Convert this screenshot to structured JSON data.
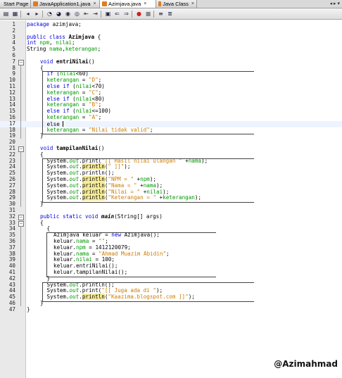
{
  "tabs": [
    {
      "label": "Start Page",
      "icon": "start-page-icon",
      "active": false
    },
    {
      "label": "JavaApplication1.java",
      "icon": "java-file-icon",
      "active": false
    },
    {
      "label": "Azimjava.java",
      "icon": "java-file-icon",
      "active": true
    },
    {
      "label": "Java Class",
      "icon": "java-file-icon",
      "active": false
    }
  ],
  "tab_close": "×",
  "tab_nav": "◂ ▸ ▾",
  "toolbar": {
    "buttons": [
      "source-icon",
      "history-icon",
      "back-icon",
      "forward-icon",
      "find-prev-icon",
      "find-next-icon",
      "find-selection-icon",
      "toggle-highlight-icon",
      "prev-bookmark-icon",
      "next-bookmark-icon",
      "toggle-bookmark-icon",
      "shift-left-icon",
      "shift-right-icon",
      "start-macro-icon",
      "stop-macro-icon",
      "comment-icon",
      "uncomment-icon"
    ]
  },
  "colors": {
    "keyword": "#0000e6",
    "string": "#ce7b00",
    "field": "#009900",
    "highlight": "#f5eb9a"
  },
  "lines": [
    {
      "n": "1",
      "t": "package azimjava;"
    },
    {
      "n": "2",
      "t": ""
    },
    {
      "n": "3",
      "t": "public class Azimjava {"
    },
    {
      "n": "4",
      "t": "int npm, nilai;"
    },
    {
      "n": "5",
      "t": "String nama,keterangan;"
    },
    {
      "n": "6",
      "t": ""
    },
    {
      "n": "7",
      "t": "void entriNilai()"
    },
    {
      "n": "8",
      "t": "{"
    },
    {
      "n": "9",
      "t": "if (nilai<60)"
    },
    {
      "n": "10",
      "t": "keterangan = \"D\";"
    },
    {
      "n": "11",
      "t": "else if (nilai<70)"
    },
    {
      "n": "12",
      "t": "keterangan = \"C\";"
    },
    {
      "n": "13",
      "t": "else if (nilai<80)"
    },
    {
      "n": "14",
      "t": "keterangan = \"B\";"
    },
    {
      "n": "15",
      "t": "else if (nilai<=100)"
    },
    {
      "n": "16",
      "t": "keterangan = \"A\";"
    },
    {
      "n": "17",
      "t": "else"
    },
    {
      "n": "18",
      "t": "keterangan = \"Nilai tidak valid\";"
    },
    {
      "n": "19",
      "t": "}"
    },
    {
      "n": "20",
      "t": ""
    },
    {
      "n": "21",
      "t": "void tampilanNilai()"
    },
    {
      "n": "22",
      "t": "{"
    },
    {
      "n": "23",
      "t": "System.out.print(\"[[ Hasil nilai ulangan \" +nama);"
    },
    {
      "n": "24",
      "t": "System.out.println(\" ]]\");"
    },
    {
      "n": "25",
      "t": "System.out.println();"
    },
    {
      "n": "26",
      "t": "System.out.println(\"NPM = \" +npm);"
    },
    {
      "n": "27",
      "t": "System.out.println(\"Nama = \" +nama);"
    },
    {
      "n": "28",
      "t": "System.out.println(\"Nilai = \" +nilai);"
    },
    {
      "n": "29",
      "t": "System.out.println(\"Keterangan = \" +keterangan);"
    },
    {
      "n": "30",
      "t": "}"
    },
    {
      "n": "31",
      "t": ""
    },
    {
      "n": "32",
      "t": "public static void main(String[] args)"
    },
    {
      "n": "33",
      "t": "{"
    },
    {
      "n": "34",
      "t": "{"
    },
    {
      "n": "35",
      "t": "Azimjava keluar = new Azimjava();"
    },
    {
      "n": "36",
      "t": "keluar.nama = \"\";"
    },
    {
      "n": "37",
      "t": "keluar.npm = 1412120079;"
    },
    {
      "n": "38",
      "t": "keluar.nama = \"Ahmad Muazim Abidin\";"
    },
    {
      "n": "39",
      "t": "keluar.nilai = 100;"
    },
    {
      "n": "40",
      "t": "keluar.entriNilai();"
    },
    {
      "n": "41",
      "t": "keluar.tampilanNilai();"
    },
    {
      "n": "42",
      "t": "}"
    },
    {
      "n": "43",
      "t": "System.out.println();"
    },
    {
      "n": "44",
      "t": "System.out.print(\"[[ Juga ada di \");"
    },
    {
      "n": "45",
      "t": "System.out.println(\"Kaazima.blogspot.com ]]\");"
    },
    {
      "n": "46",
      "t": "}"
    },
    {
      "n": "47",
      "t": "}"
    }
  ],
  "watermark": "@Azimahmad"
}
